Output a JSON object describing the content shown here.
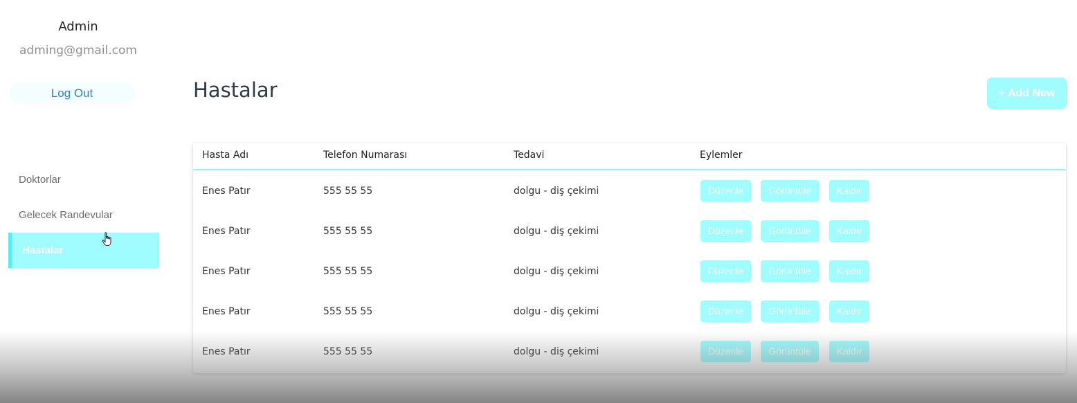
{
  "user": {
    "name": "Admin",
    "email": "adming@gmail.com"
  },
  "logout_label": "Log Out",
  "nav": [
    {
      "label": "Doktorlar",
      "active": false
    },
    {
      "label": "Gelecek Randevular",
      "active": false
    },
    {
      "label": "Hastalar",
      "active": true
    }
  ],
  "page": {
    "title": "Hastalar",
    "add_label": "+ Add New"
  },
  "table": {
    "headers": [
      "Hasta Adı",
      "Telefon Numarası",
      "Tedavi",
      "Eylemler"
    ],
    "actions": [
      "Düzenle",
      "Görüntüle",
      "Kaldır"
    ],
    "rows": [
      [
        "Enes Patır",
        "555 55 55",
        "dolgu - diş çekimi"
      ],
      [
        "Enes Patır",
        "555 55 55",
        "dolgu - diş çekimi"
      ],
      [
        "Enes Patır",
        "555 55 55",
        "dolgu - diş çekimi"
      ],
      [
        "Enes Patır",
        "555 55 55",
        "dolgu - diş çekimi"
      ],
      [
        "Enes Patır",
        "555 55 55",
        "dolgu - diş çekimi"
      ]
    ]
  },
  "colors": {
    "accent": "#9ffcff",
    "accent_border": "#54eef4",
    "link": "#2b86c8"
  },
  "icons": {
    "cursor": "hand-pointer-icon"
  }
}
